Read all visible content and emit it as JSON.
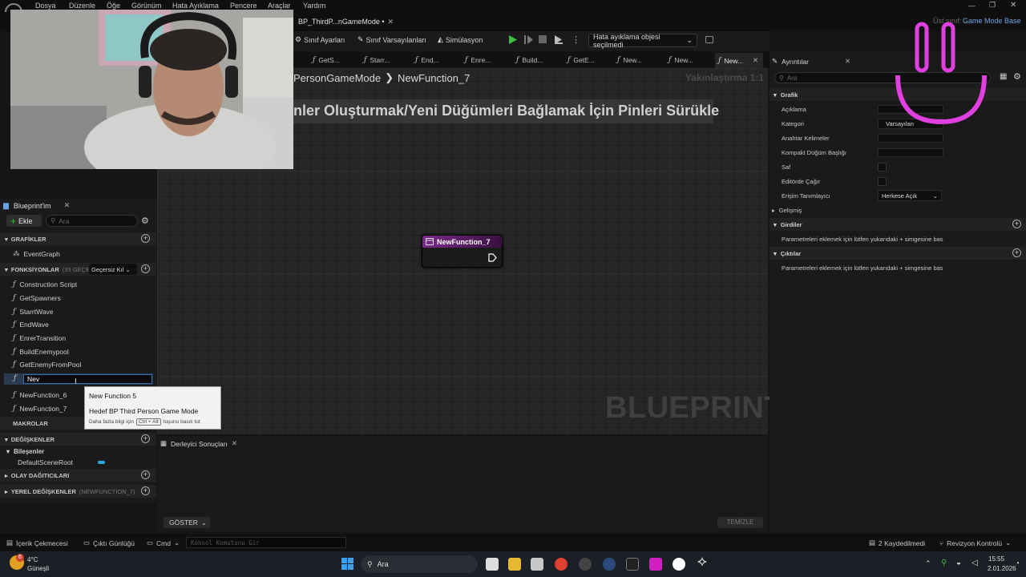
{
  "menu": [
    "Dosya",
    "Düzenle",
    "Öğe",
    "Görünüm",
    "Hata Ayıklama",
    "Pencere",
    "Araçlar",
    "Yardım"
  ],
  "document_tab": "BP_ThirdP...nGameMode •",
  "parent_class": {
    "label": "Üst sınıf:",
    "value": "Game Mode Base"
  },
  "toolbar": {
    "class_settings": "Sınıf Ayarları",
    "class_defaults": "Sınıf Varsayılanları",
    "simulation": "Simülasyon",
    "debug_select": "Hata ayıklama objesi seçilmedi"
  },
  "function_tabs": [
    "GetS...",
    "Starr...",
    "End...",
    "Enre...",
    "Build...",
    "GetE...",
    "New...",
    "New...",
    "New..."
  ],
  "graph": {
    "breadcrumb_parent": "PersonGameMode",
    "breadcrumb_sep": "❯",
    "breadcrumb_current": "NewFunction_7",
    "zoom": "Yakınlaştırma 1:1",
    "hint": "nler Oluşturmak/Yeni Düğümleri Bağlamak İçin Pinleri Sürükle",
    "watermark": "BLUEPRINT",
    "node_title": "NewFunction_7"
  },
  "my_blueprint": {
    "tab": "Blueprint'im",
    "add": "Ekle",
    "search_placeholder": "Ara",
    "graphs_header": "GRAFİKLER",
    "event_graph": "EventGraph",
    "functions_header": "FONKSİYONLAR",
    "functions_count": "(33 GEÇERSİ",
    "filter": "Geçersiz Kıl",
    "functions": [
      "Construction Script",
      "GetSpawners",
      "StarrtWave",
      "EndWave",
      "EnrerTransition",
      "BuildEnemypool",
      "GetEnemyFromPool"
    ],
    "rename_value": "Nev",
    "functions_after": [
      "NewFunction_6",
      "NewFunction_7"
    ],
    "macros_header": "MAKROLAR",
    "variables_header": "DEĞİŞKENLER",
    "components_label": "Bileşenler",
    "component": "DefaultSceneRoot",
    "dispatchers_header": "OLAY DAĞITICILARI",
    "locals_header": "YEREL DEĞİŞKENLER",
    "locals_sub": "(NEWFUNCTION_7)"
  },
  "tooltip": {
    "line1": "New Function 5",
    "line2": "Hedef BP Third Person Game Mode",
    "line3_a": "Daha fazla bilgi için",
    "line3_key": "Ctrl + Alt",
    "line3_b": "tuşunu basılı tut"
  },
  "compiler": {
    "tab": "Derleyici Sonuçları",
    "show": "GÖSTER",
    "clear": "TEMİZLE"
  },
  "details": {
    "tab": "Ayrıntılar",
    "search_placeholder": "Ara",
    "graph_header": "Grafik",
    "description": "Açıklama",
    "category": "Kategori",
    "category_value": "Varsayılan",
    "keywords": "Anahtar Kelimeler",
    "compact_title": "Kompakt Düğüm Başlığı",
    "pure": "Saf",
    "call_in_editor": "Editörde Çağır",
    "access": "Erişim Tanımlayıcı",
    "access_value": "Herkese Açık",
    "advanced": "Gelişmiş",
    "inputs_header": "Girdiler",
    "inputs_msg": "Parametreleri eklemek için lütfen yukarıdaki + simgesine bas",
    "outputs_header": "Çıktılar",
    "outputs_msg": "Parametreleri eklemek için lütfen yukarıdaki + simgesine bas"
  },
  "statusbar": {
    "content_drawer": "İçerik Çekmecesi",
    "output_log": "Çıktı Günlüğü",
    "cmd": "Cmd",
    "console_placeholder": "Konsol Komutunu Gir",
    "saved": "2 Kaydedilmedi",
    "revision": "Revizyon Kontrolü"
  },
  "taskbar": {
    "weather_temp": "4°C",
    "weather_desc": "Güneşli",
    "weather_badge": "6",
    "search": "Ara",
    "time": "15:55",
    "date": "2.01.2026"
  },
  "colors": {
    "accent_purple": "#7a2a8a",
    "neon": "#e040e0",
    "selection": "#2f6ea8"
  }
}
